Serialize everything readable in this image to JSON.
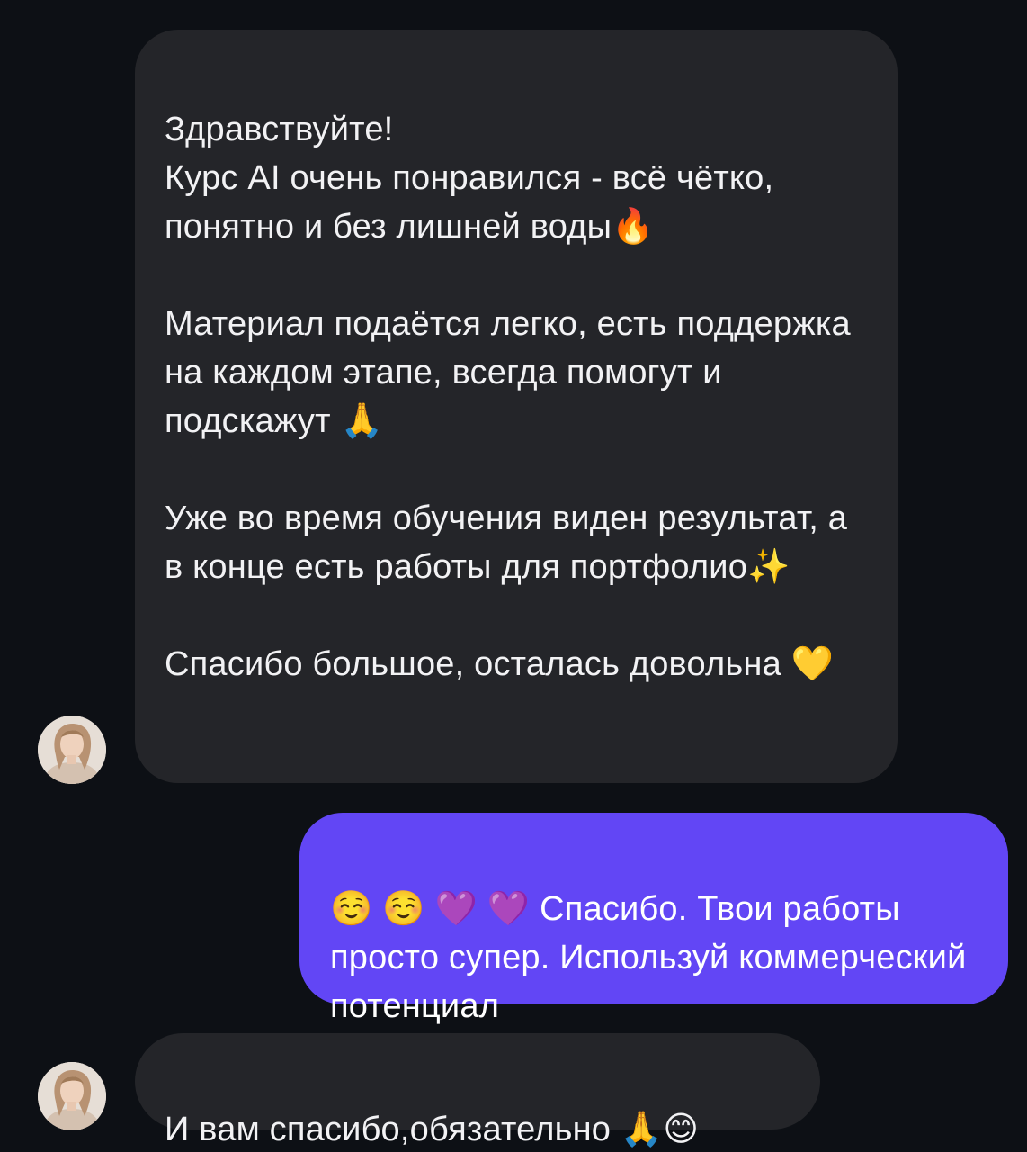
{
  "colors": {
    "background": "#0d1015",
    "incoming_bubble": "#242529",
    "outgoing_bubble": "#6246f5",
    "text": "#f2f2f4"
  },
  "messages": [
    {
      "direction": "incoming",
      "text": "Здравствуйте!\nКурс AI очень понравился - всё чётко, понятно и без лишней воды🔥\n\nМатериал подаётся легко, есть поддержка на каждом этапе, всегда помогут и подскажут 🙏\n\nУже во время обучения виден результат, а в конце есть работы для портфолио✨\n\nСпасибо большое, осталась довольна 💛"
    },
    {
      "direction": "outgoing",
      "text": "☺️ ☺️ 💜 💜 Спасибо. Твои работы просто супер. Используй коммерческий потенциал"
    },
    {
      "direction": "incoming",
      "text": "И вам спасибо,обязательно 🙏😊"
    }
  ],
  "avatar_icon": "user-avatar-icon"
}
